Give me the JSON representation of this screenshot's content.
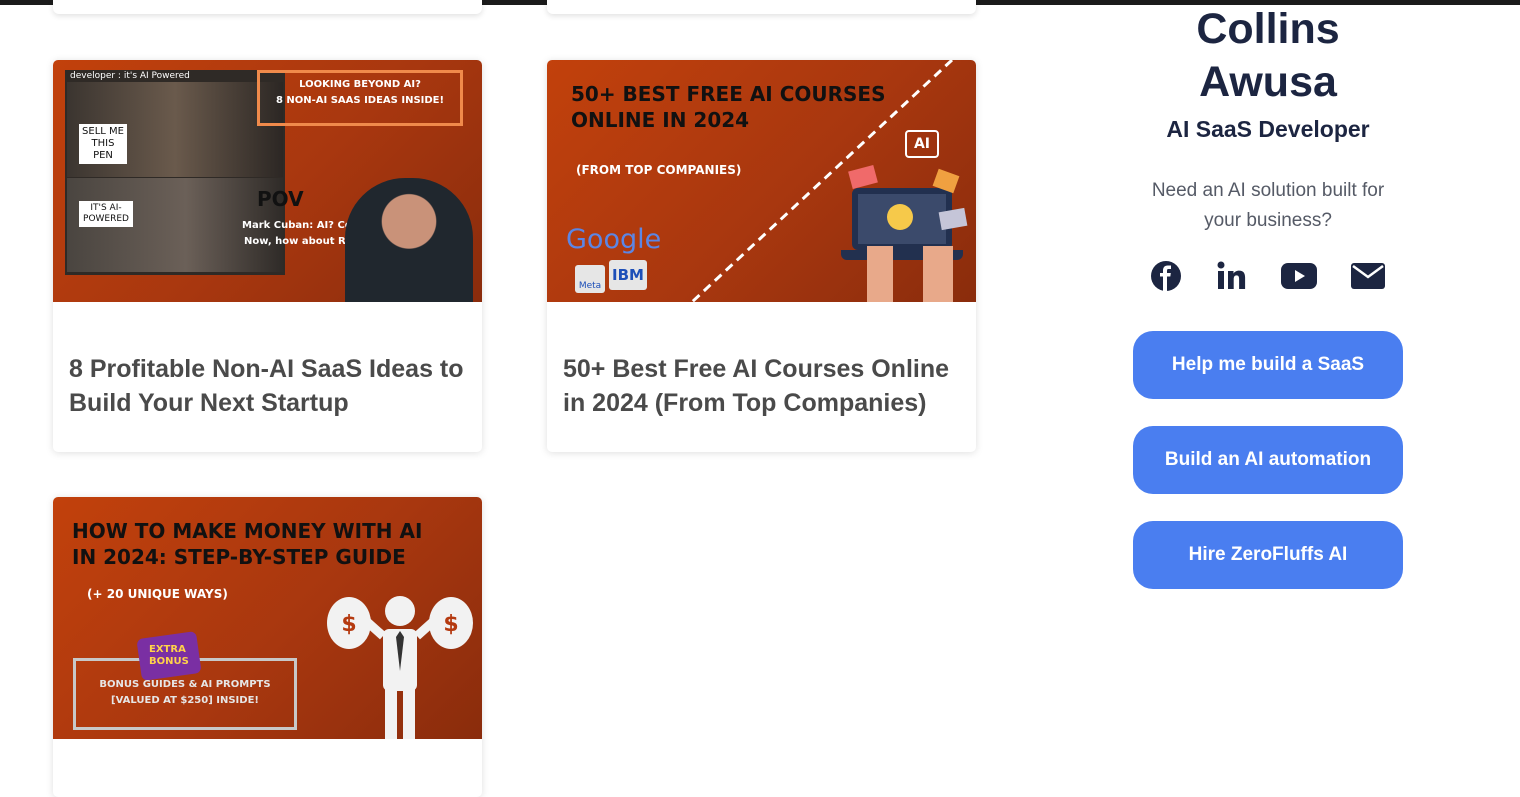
{
  "profile": {
    "name_line1": "Collins",
    "name_line2": "Awusa",
    "role": "AI SaaS Developer",
    "tagline_line1": "Need an AI solution built for",
    "tagline_line2": "your business?",
    "socials": [
      "facebook-icon",
      "linkedin-icon",
      "youtube-icon",
      "email-icon"
    ],
    "buttons": [
      "Help me build a SaaS",
      "Build an AI automation",
      "Hire ZeroFluffs AI"
    ]
  },
  "posts": [
    {
      "title": "8 Profitable Non-AI SaaS Ideas to Build Your Next Startup",
      "thumb": {
        "caption": "developer : it's AI Powered",
        "box_line1": "LOOKING BEYOND AI?",
        "box_line2": "8 NON-AI SAAS IDEAS INSIDE!",
        "bubble1": "SELL ME THIS PEN",
        "bubble2": "IT'S AI-POWERED",
        "pov": "POV",
        "quote_line1": "Mark Cuban: AI? Cool.",
        "quote_line2": "Now, how about ROI?"
      }
    },
    {
      "title": "50+ Best Free AI Courses Online in 2024 (From Top Companies)",
      "thumb": {
        "headline_line1": "50+ BEST FREE AI COURSES",
        "headline_line2": "ONLINE IN 2024",
        "sub": "(FROM TOP COMPANIES)",
        "google": "Google",
        "meta": "Meta",
        "ibm": "IBM",
        "ai_chip": "AI"
      }
    },
    {
      "title": "",
      "thumb": {
        "headline_line1": "HOW TO MAKE MONEY WITH AI",
        "headline_line2": "IN 2024: STEP-BY-STEP GUIDE",
        "sub": "(+ 20 UNIQUE WAYS)",
        "extra": "EXTRA",
        "bonus": "BONUS",
        "box_line1": "BONUS GUIDES & AI PROMPTS",
        "box_line2": "[VALUED AT $250] INSIDE!"
      }
    }
  ],
  "colors": {
    "accent": "#4a7ef0",
    "heading": "#1c2541",
    "thumb_orange": "#b53a10"
  }
}
